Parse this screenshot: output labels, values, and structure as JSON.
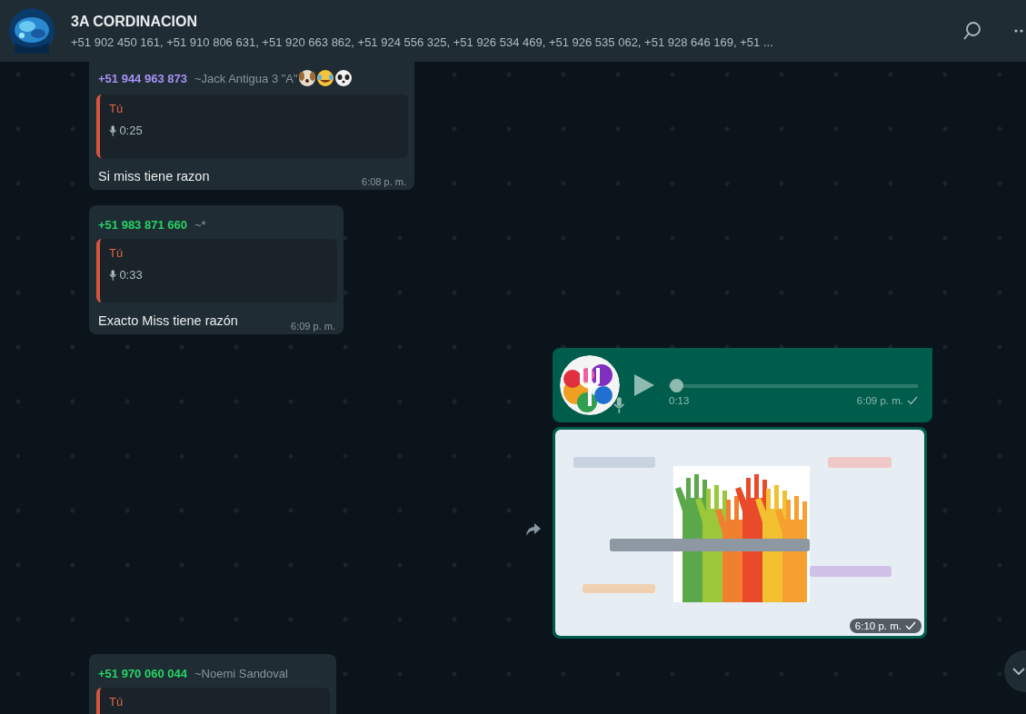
{
  "header": {
    "title": "3A CORDINACION",
    "members": "+51 902 450 161, +51 910 806 631, +51 920 663 862, +51 924 556 325, +51 926 534 469, +51 926 535 062, +51 928 646 169, +51 ..."
  },
  "messages": [
    {
      "kind": "incoming",
      "sender": "+51 944 963 873",
      "color": "#a791f5",
      "alias": "~Jack Antigua 3 \"A\"",
      "emojis": true,
      "quote_author": "Tú",
      "quote_duration": "0:25",
      "text": "Si miss tiene razon",
      "time": "6:08 p. m."
    },
    {
      "kind": "incoming",
      "sender": "+51 983 871 660",
      "color": "#25d366",
      "alias": "~*",
      "quote_author": "Tú",
      "quote_duration": "0:33",
      "text": "Exacto Miss tiene razón",
      "time": "6:09 p. m."
    },
    {
      "kind": "audio",
      "level": 0,
      "duration": "0:13",
      "time": "6:09 p. m."
    },
    {
      "time": "6:10 p. m."
    },
    {
      "kind": "incoming",
      "sender": "+51 970 060 044",
      "color": "#25d366",
      "alias": "~Noemi Sandoval",
      "quote_author": "Tú"
    }
  ]
}
